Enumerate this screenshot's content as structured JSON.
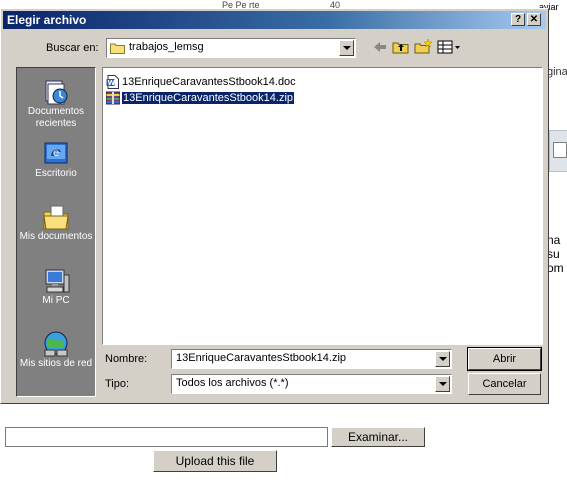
{
  "background_page": {
    "top_fragments": [
      "Pe Pe rte",
      "40",
      "aviar"
    ],
    "right_fragment": "gina",
    "side_fragments": [
      "na",
      "su",
      "om"
    ],
    "upload": {
      "file_input_value": "",
      "browse_label": "Examinar...",
      "upload_label": "Upload this file"
    }
  },
  "dialog": {
    "title": "Elegir archivo",
    "title_buttons": {
      "help": "?",
      "close": "✕"
    },
    "look_in_label": "Buscar en:",
    "look_in_value": "trabajos_lemsg",
    "places": [
      {
        "label": "Documentos recientes",
        "icon": "recent-documents-icon"
      },
      {
        "label": "Escritorio",
        "icon": "desktop-icon"
      },
      {
        "label": "Mis documentos",
        "icon": "my-documents-icon"
      },
      {
        "label": "Mi PC",
        "icon": "my-computer-icon"
      },
      {
        "label": "Mis sitios de red",
        "icon": "network-places-icon"
      }
    ],
    "files": [
      {
        "name": "13EnriqueCaravantesStbook14.doc",
        "icon": "word-document-icon",
        "selected": false
      },
      {
        "name": "13EnriqueCaravantesStbook14.zip",
        "icon": "zip-archive-icon",
        "selected": true
      }
    ],
    "filename_label": "Nombre:",
    "filename_value": "13EnriqueCaravantesStbook14.zip",
    "filetype_label": "Tipo:",
    "filetype_value": "Todos los archivos (*.*)",
    "open_button": "Abrir",
    "cancel_button": "Cancelar"
  },
  "colors": {
    "titlebar_start": "#0a246a",
    "titlebar_end": "#a6caf0",
    "dialog_face": "#d4d0c8",
    "places_bar": "#808080",
    "selection": "#0a246a"
  }
}
